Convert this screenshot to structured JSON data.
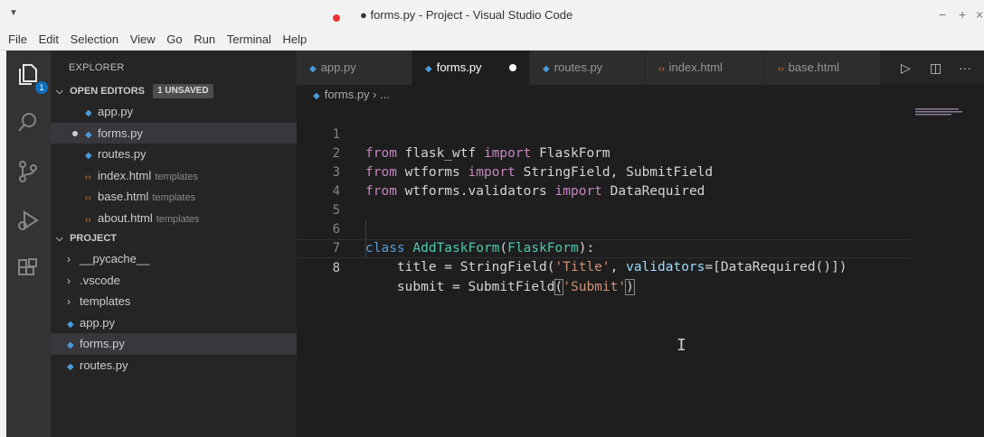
{
  "window": {
    "title": "● forms.py - Project - Visual Studio Code",
    "controls": [
      "−",
      "+",
      "×"
    ]
  },
  "menu": [
    "File",
    "Edit",
    "Selection",
    "View",
    "Go",
    "Run",
    "Terminal",
    "Help"
  ],
  "activity_bar": {
    "icons": [
      "files-icon",
      "search-icon",
      "source-control-icon",
      "run-debug-icon",
      "extensions-icon"
    ],
    "badge": "1"
  },
  "sidebar": {
    "header": "EXPLORER",
    "open_editors": {
      "title": "OPEN EDITORS",
      "badge": "1 UNSAVED",
      "items": [
        {
          "name": "app.py",
          "hint": ""
        },
        {
          "name": "forms.py",
          "hint": ""
        },
        {
          "name": "routes.py",
          "hint": ""
        },
        {
          "name": "index.html",
          "hint": "templates"
        },
        {
          "name": "base.html",
          "hint": "templates"
        },
        {
          "name": "about.html",
          "hint": "templates"
        }
      ]
    },
    "project": {
      "title": "PROJECT",
      "folders": [
        "__pycache__",
        ".vscode",
        "templates"
      ],
      "files": [
        "app.py",
        "forms.py",
        "routes.py"
      ]
    }
  },
  "tabs": [
    {
      "label": "app.py"
    },
    {
      "label": "forms.py"
    },
    {
      "label": "routes.py"
    },
    {
      "label": "index.html"
    },
    {
      "label": "base.html"
    }
  ],
  "tab_actions": [
    "▷",
    "◫",
    "···"
  ],
  "breadcrumb": {
    "file": "forms.py",
    "rest": "› ..."
  },
  "editor": {
    "line_numbers": [
      "1",
      "2",
      "3",
      "4",
      "5",
      "6",
      "7",
      "8"
    ],
    "tokens": {
      "l1": [
        "from",
        " flask_wtf ",
        "import",
        " FlaskForm"
      ],
      "l2": [
        "from",
        " wtforms ",
        "import",
        " StringField, SubmitField"
      ],
      "l3": [
        "from",
        " wtforms.validators ",
        "import",
        " DataRequired"
      ],
      "l6": [
        "class",
        " ",
        "AddTaskForm",
        "(",
        "FlaskForm",
        "):"
      ],
      "l7": [
        "    title = StringField(",
        "'Title'",
        ", ",
        "validators",
        "=[DataRequired()])"
      ],
      "l8": [
        "    submit = SubmitField",
        "(",
        "'Submit'",
        ")"
      ]
    }
  },
  "colors": {
    "keyword": "#c586c0",
    "class_keyword": "#569cd6",
    "class_name": "#4ec9b0",
    "string": "#ce9178",
    "param": "#9cdcfe",
    "python_icon": "#4b9ad8",
    "html_icon": "#e37933",
    "unsaved_dot": "#e33333"
  }
}
